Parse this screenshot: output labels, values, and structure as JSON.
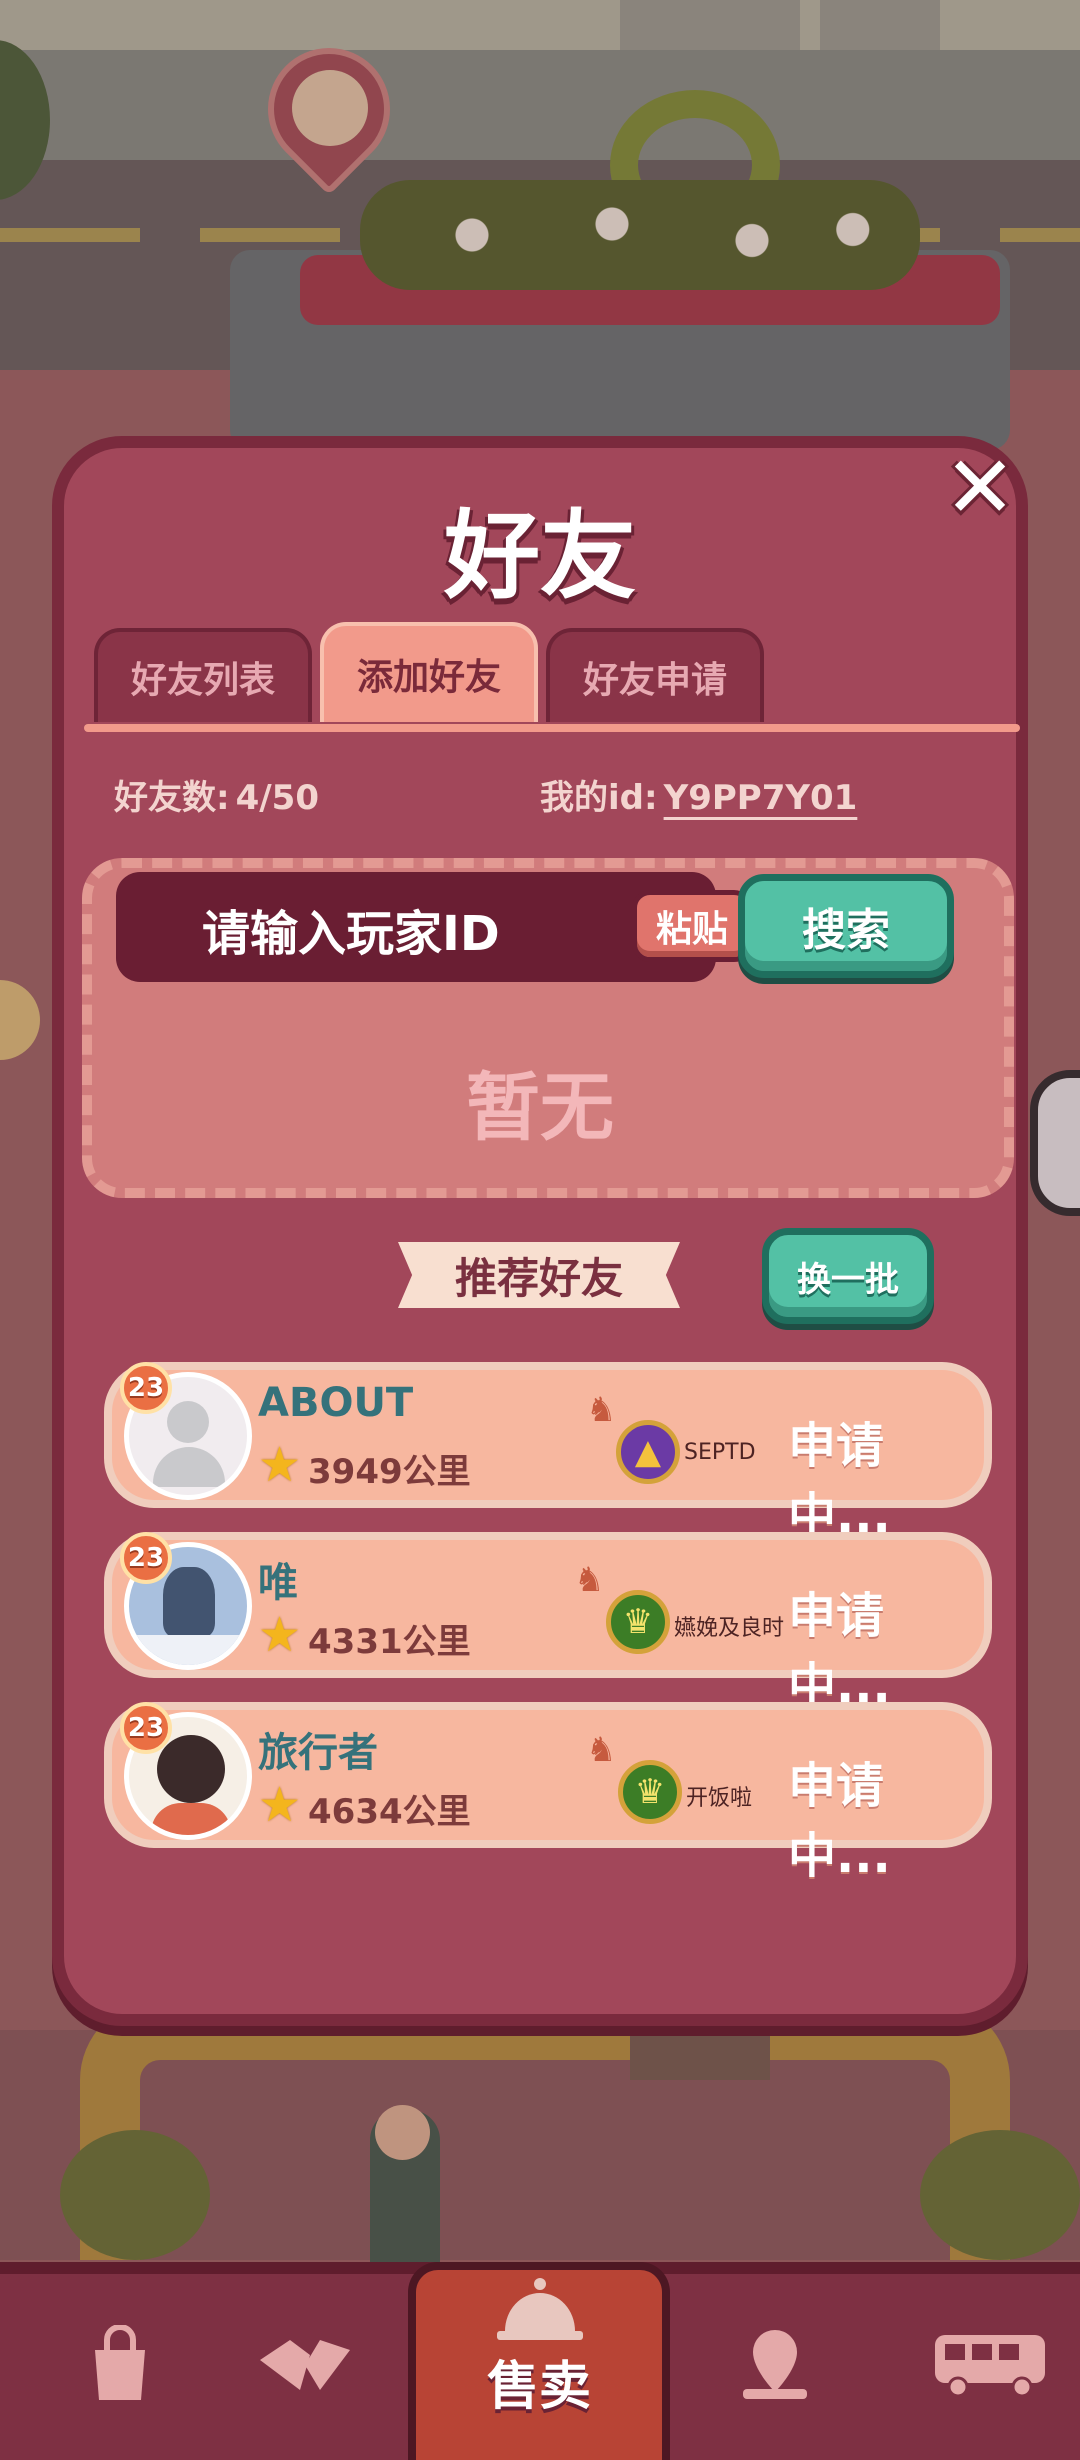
{
  "dialog": {
    "title": "好友",
    "tabs": [
      {
        "label": "好友列表",
        "active": false
      },
      {
        "label": "添加好友",
        "active": true
      },
      {
        "label": "好友申请",
        "active": false
      }
    ],
    "friend_count_label": "好友数:",
    "friend_count_value": "4/50",
    "my_id_label": "我的id:",
    "my_id_value": "Y9PP7Y01",
    "search": {
      "placeholder": "请输入玩家ID",
      "paste_label": "粘贴",
      "search_label": "搜索"
    },
    "empty_text": "暂无",
    "recommend_title": "推荐好友",
    "refresh_label": "换一批",
    "friends": [
      {
        "level": "23",
        "name": "ABOUT",
        "distance": "3949公里",
        "guild": "SEPTD",
        "status": "申请中..."
      },
      {
        "level": "23",
        "name": "唯",
        "distance": "4331公里",
        "guild": "嬿娩及良时",
        "status": "申请中..."
      },
      {
        "level": "23",
        "name": "旅行者",
        "distance": "4634公里",
        "guild": "开饭啦",
        "status": "申请中..."
      }
    ]
  },
  "bottom_nav": {
    "sell_label": "售卖",
    "items": [
      "bag-icon",
      "handshake-icon",
      "bell-icon",
      "map-pin-icon",
      "bus-icon"
    ]
  },
  "colors": {
    "dialog_bg": "#a2475a",
    "tab_active": "#f29a8b",
    "teal_button": "#53c1a5",
    "card_bg": "#f7b79f",
    "name_color": "#35727b"
  }
}
